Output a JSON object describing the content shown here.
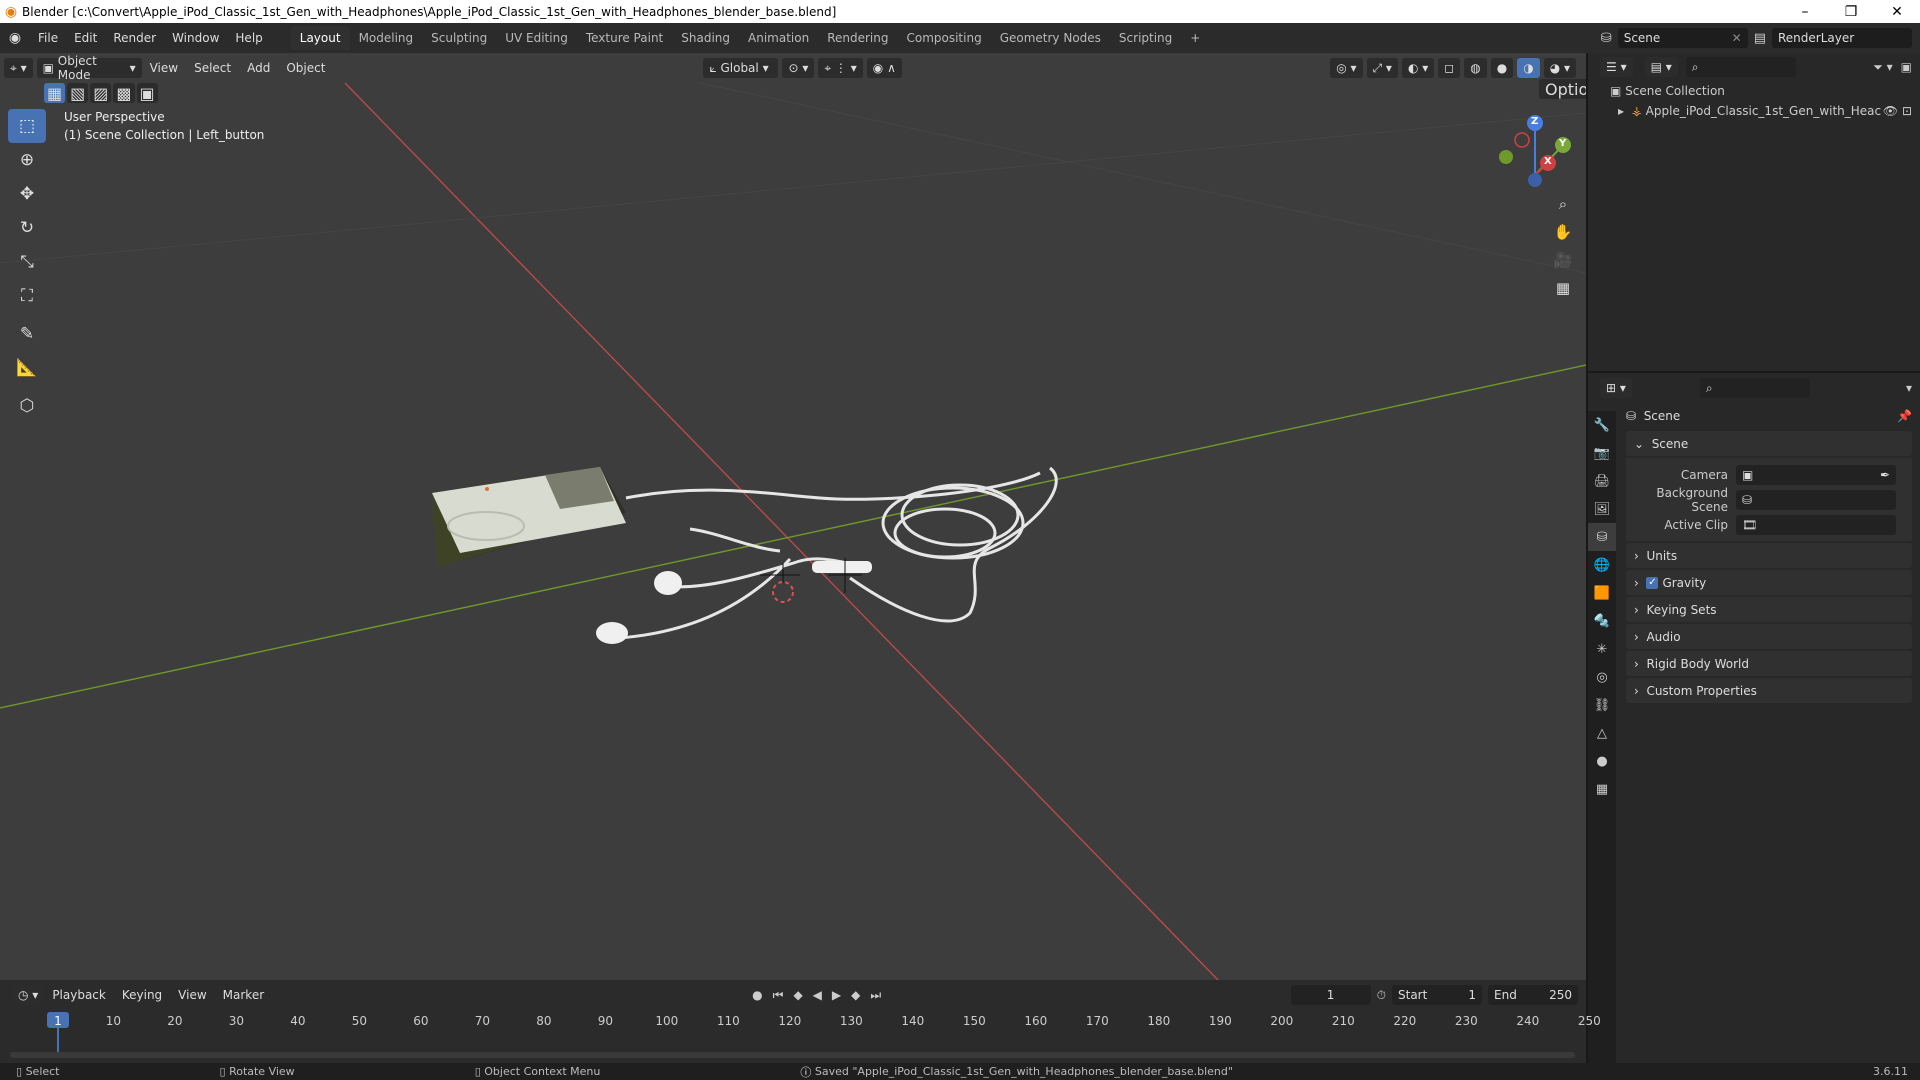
{
  "window": {
    "title": "Blender [c:\\Convert\\Apple_iPod_Classic_1st_Gen_with_Headphones\\Apple_iPod_Classic_1st_Gen_with_Headphones_blender_base.blend]",
    "minimize": "–",
    "maximize": "❐",
    "close": "✕"
  },
  "menu": [
    "File",
    "Edit",
    "Render",
    "Window",
    "Help"
  ],
  "workspaces": [
    "Layout",
    "Modeling",
    "Sculpting",
    "UV Editing",
    "Texture Paint",
    "Shading",
    "Animation",
    "Rendering",
    "Compositing",
    "Geometry Nodes",
    "Scripting"
  ],
  "workspace_add": "+",
  "active_workspace": "Layout",
  "scene_name": "Scene",
  "render_layer": "RenderLayer",
  "viewport": {
    "mode": "Object Mode",
    "menus": [
      "View",
      "Select",
      "Add",
      "Object"
    ],
    "orientation": "Global",
    "options": "Options",
    "overlay_line1": "User Perspective",
    "overlay_line2": "(1) Scene Collection | Left_button",
    "gizmo": {
      "z": "Z",
      "y": "Y",
      "x": "X"
    }
  },
  "outliner": {
    "root": "Scene Collection",
    "item": "Apple_iPod_Classic_1st_Gen_with_Heac"
  },
  "properties": {
    "header": "Scene",
    "panel": "Scene",
    "fields": [
      {
        "label": "Camera"
      },
      {
        "label": "Background Scene"
      },
      {
        "label": "Active Clip"
      }
    ],
    "sections": [
      "Units",
      "Gravity",
      "Keying Sets",
      "Audio",
      "Rigid Body World",
      "Custom Properties"
    ],
    "gravity_checked": true
  },
  "timeline": {
    "menus": [
      "Playback",
      "Keying",
      "View",
      "Marker"
    ],
    "current_frame": "1",
    "start_label": "Start",
    "start": "1",
    "end_label": "End",
    "end": "250",
    "ticks": [
      "1",
      "10",
      "20",
      "30",
      "40",
      "50",
      "60",
      "70",
      "80",
      "90",
      "100",
      "110",
      "120",
      "130",
      "140",
      "150",
      "160",
      "170",
      "180",
      "190",
      "200",
      "210",
      "220",
      "230",
      "240",
      "250"
    ]
  },
  "status": {
    "select": "Select",
    "rotate": "Rotate View",
    "context": "Object Context Menu",
    "message": "Saved \"Apple_iPod_Classic_1st_Gen_with_Headphones_blender_base.blend\"",
    "version": "3.6.11"
  },
  "colors": {
    "accent": "#4772b3",
    "x_axis": "#b84a4a",
    "y_axis": "#6f9a2a",
    "viewport_bg": "#3d3d3d"
  }
}
